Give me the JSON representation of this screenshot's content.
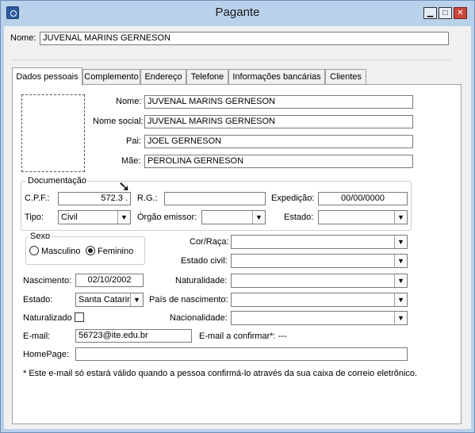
{
  "window": {
    "title": "Pagante",
    "minimize": "▁",
    "maximize": "□",
    "close": "✕"
  },
  "top": {
    "nome_label": "Nome:",
    "nome_value": "JUVENAL MARINS GERNESON"
  },
  "tabs": [
    {
      "label": "Dados pessoais",
      "active": true
    },
    {
      "label": "Complemento",
      "active": false
    },
    {
      "label": "Endereço",
      "active": false
    },
    {
      "label": "Telefone",
      "active": false
    },
    {
      "label": "Informações bancárias",
      "active": false
    },
    {
      "label": "Clientes",
      "active": false
    }
  ],
  "personal": {
    "nome_label": "Nome:",
    "nome_value": "JUVENAL MARINS GERNESON",
    "nome_social_label": "Nome social:",
    "nome_social_value": "JUVENAL MARINS GERNESON",
    "pai_label": "Pai:",
    "pai_value": "JOEL GERNESON",
    "mae_label": "Mãe:",
    "mae_value": "PEROLINA GERNESON"
  },
  "documentacao": {
    "title": "Documentação",
    "cpf_label": "C.P.F.:",
    "cpf_value": "572.3 .",
    "rg_label": "R.G.:",
    "rg_value": "",
    "expedicao_label": "Expedição:",
    "expedicao_value": "00/00/0000",
    "tipo_label": "Tipo:",
    "tipo_value": "Civil",
    "orgao_label": "Órgão emissor:",
    "orgao_value": "",
    "estado_label": "Estado:",
    "estado_value": ""
  },
  "sexo": {
    "title": "Sexo",
    "masculino": "Masculino",
    "feminino": "Feminino",
    "selected": "Feminino"
  },
  "right": {
    "cor_label": "Cor/Raça:",
    "cor_value": "",
    "estado_civil_label": "Estado civil:",
    "estado_civil_value": "",
    "naturalidade_label": "Naturalidade:",
    "naturalidade_value": "",
    "pais_label": "País de nascimento:",
    "pais_value": "",
    "nacionalidade_label": "Nacionalidade:",
    "nacionalidade_value": ""
  },
  "left": {
    "nascimento_label": "Nascimento:",
    "nascimento_value": "02/10/2002",
    "estado_label": "Estado:",
    "estado_value": "Santa Catarin",
    "naturalizado_label": "Naturalizado",
    "email_label": "E-mail:",
    "email_value": "56723@ite.edu.br",
    "email_confirm_label": "E-mail a confirmar*: ---",
    "homepage_label": "HomePage:",
    "homepage_value": "",
    "note": "* Este e-mail só estará válido quando a pessoa confirmá-lo através da sua caixa de correio eletrônico."
  }
}
